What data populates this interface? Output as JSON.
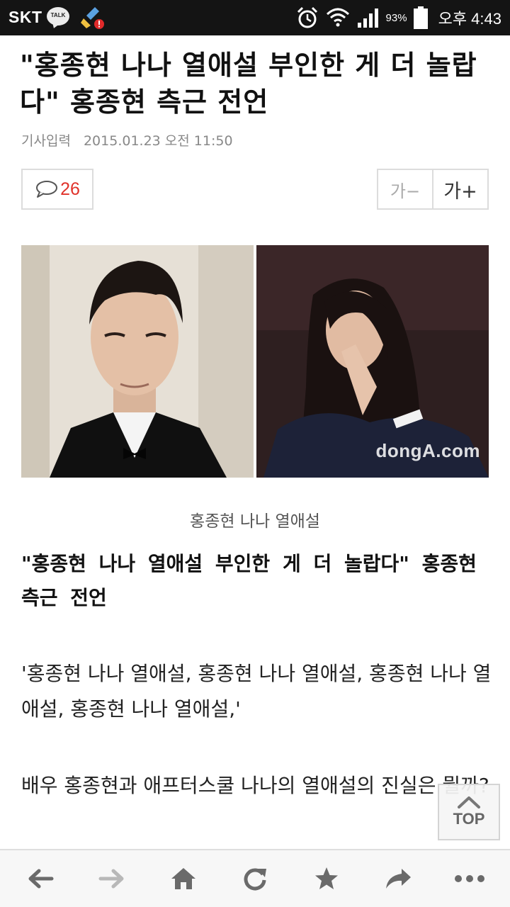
{
  "status_bar": {
    "carrier": "SKT",
    "talk_label": "TALK",
    "battery": "93%",
    "time": "오후 4:43"
  },
  "article": {
    "title": "\"홍종현 나나 열애설 부인한 게 더 놀랍다\" 홍종현 측근 전언",
    "meta_label": "기사입력",
    "meta_date": "2015.01.23 오전 11:50",
    "comment_count": "26",
    "font_minus": "가−",
    "font_plus": "가+",
    "photo_watermark": "dongA.com",
    "photo_caption": "홍종현 나나 열애설",
    "subhead": "\"홍종현 나나 열애설 부인한 게 더 놀랍다\" 홍종현 측근 전언",
    "paragraphs": [
      "'홍종현 나나 열애설, 홍종현 나나 열애설, 홍종현 나나 열애설, 홍종현 나나 열애설,'",
      "배우 홍종현과 애프터스쿨 나나의 열애설의 진실은 뭘까?"
    ]
  },
  "top_button": {
    "label": "TOP"
  },
  "toolbar": {
    "icons": [
      "back-arrow-icon",
      "forward-arrow-icon",
      "home-icon",
      "refresh-icon",
      "star-icon",
      "share-icon",
      "more-icon"
    ]
  },
  "colors": {
    "status_bar_bg": "#141414",
    "comment_count": "#e0322a",
    "toolbar_bg": "#f7f7f7"
  }
}
